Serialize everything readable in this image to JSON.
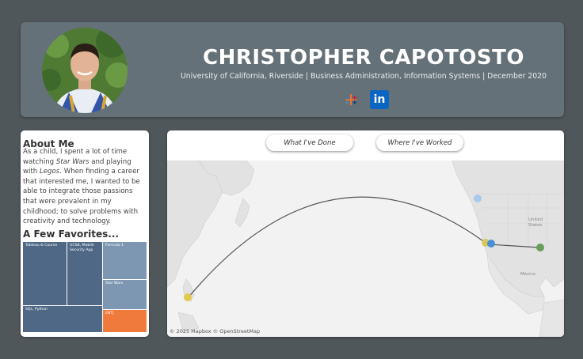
{
  "header": {
    "name": "CHRISTOPHER CAPOTOSTO",
    "subtitle": "University of California, Riverside | Business Administration, Information Systems | December 2020",
    "linkedin_label": "in"
  },
  "about": {
    "title": "About Me",
    "text_a": "As a child, I spent a lot of time watching ",
    "text_b": "Star Wars",
    "text_c": " and playing with ",
    "text_d": "Legos",
    "text_e": ". When finding a career that interested me, I wanted to be able to integrate those passions that were prevalent in my childhood; to solve problems with creativity and technology.",
    "favorites_title": "A Few Favorites...",
    "favorites": [
      "Tableau & Course",
      "UCSB, Mobile Security App",
      "Formula 1",
      "Star Wars",
      "SQL, Python",
      "ENTJ"
    ]
  },
  "buttons": {
    "done": "What I've Done",
    "worked": "Where I've Worked"
  },
  "map": {
    "label_us1": "United",
    "label_us2": "States",
    "label_mexico": "México",
    "attribution": "© 2025 Mapbox  © OpenStreetMap"
  },
  "colors": {
    "header_bg": "#647178",
    "treemap_dark": "#4e6886",
    "treemap_light": "#7d97b2",
    "treemap_accent": "#f07a3c",
    "linkedin": "#0a66c2"
  }
}
